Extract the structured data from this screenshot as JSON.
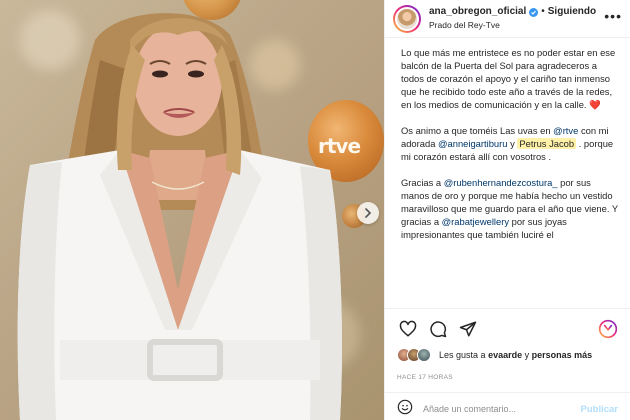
{
  "post": {
    "username": "ana_obregon_oficial",
    "separator": "•",
    "follow_label": "Siguiendo",
    "location": "Prado del Rey-Tve",
    "more_icon": "more-horizontal-icon",
    "photo_overlay_text": "rtve"
  },
  "caption": {
    "p1": "Lo que más me entristece es no poder estar en ese balcón de la Puerta del Sol para agradeceros a todos de corazón el apoyo y el cariño tan inmenso que he recibido todo este año a través de la redes, en los medios de comunicación y en la calle.",
    "p1_emoji": "❤️",
    "p2_a": "Os animo a que toméis Las uvas en",
    "p2_mention1": "@rtve",
    "p2_b": "con mi adorada",
    "p2_mention2": "@anneigartiburu",
    "p2_c": "y",
    "p2_tag": "Petrus Jacob",
    "p2_d": ". porque mi corazón estará allí con vosotros .",
    "p3_a": "Gracias a",
    "p3_mention1": "@rubenhernandezcostura_",
    "p3_b": "por sus manos de oro y porque me había hecho un vestido maravilloso que me guardo para el año que viene. Y gracias a",
    "p3_mention2": "@rabatjewellery",
    "p3_c": "por sus joyas impresionantes que también luciré el"
  },
  "likes": {
    "prefix": "Les gusta a",
    "user": "evaarde",
    "middle": "y",
    "others": "personas más"
  },
  "time": "HACE 17 HORAS",
  "comment": {
    "placeholder": "Añade un comentario...",
    "publish_label": "Publicar"
  },
  "colors": {
    "mention": "#00376b",
    "verified": "#3897f0",
    "publish_disabled": "#b2dffc",
    "heart": "#ed4956",
    "tag_highlight": "#fff1a8"
  }
}
